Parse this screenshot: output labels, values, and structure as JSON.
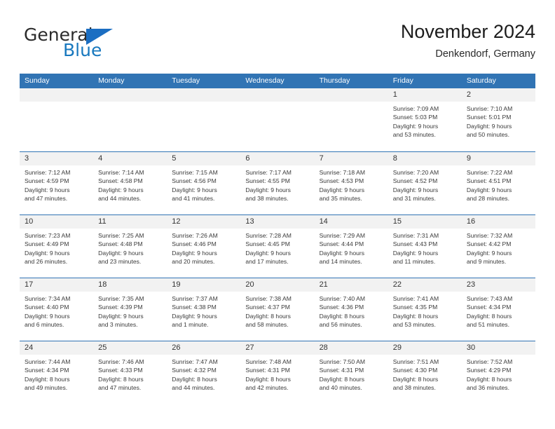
{
  "logo": {
    "primary_text": "General",
    "secondary_text": "Blue",
    "brand_color": "#1b6ec2"
  },
  "header": {
    "title": "November 2024",
    "subtitle": "Denkendorf, Germany"
  },
  "calendar": {
    "header_color": "#3174b4",
    "weekdays": [
      "Sunday",
      "Monday",
      "Tuesday",
      "Wednesday",
      "Thursday",
      "Friday",
      "Saturday"
    ],
    "weeks": [
      [
        {
          "day": "",
          "empty": true,
          "sunrise": "",
          "sunset": "",
          "daylight_line1": "",
          "daylight_line2": ""
        },
        {
          "day": "",
          "empty": true,
          "sunrise": "",
          "sunset": "",
          "daylight_line1": "",
          "daylight_line2": ""
        },
        {
          "day": "",
          "empty": true,
          "sunrise": "",
          "sunset": "",
          "daylight_line1": "",
          "daylight_line2": ""
        },
        {
          "day": "",
          "empty": true,
          "sunrise": "",
          "sunset": "",
          "daylight_line1": "",
          "daylight_line2": ""
        },
        {
          "day": "",
          "empty": true,
          "sunrise": "",
          "sunset": "",
          "daylight_line1": "",
          "daylight_line2": ""
        },
        {
          "day": "1",
          "empty": false,
          "sunrise": "Sunrise: 7:09 AM",
          "sunset": "Sunset: 5:03 PM",
          "daylight_line1": "Daylight: 9 hours",
          "daylight_line2": "and 53 minutes."
        },
        {
          "day": "2",
          "empty": false,
          "sunrise": "Sunrise: 7:10 AM",
          "sunset": "Sunset: 5:01 PM",
          "daylight_line1": "Daylight: 9 hours",
          "daylight_line2": "and 50 minutes."
        }
      ],
      [
        {
          "day": "3",
          "empty": false,
          "sunrise": "Sunrise: 7:12 AM",
          "sunset": "Sunset: 4:59 PM",
          "daylight_line1": "Daylight: 9 hours",
          "daylight_line2": "and 47 minutes."
        },
        {
          "day": "4",
          "empty": false,
          "sunrise": "Sunrise: 7:14 AM",
          "sunset": "Sunset: 4:58 PM",
          "daylight_line1": "Daylight: 9 hours",
          "daylight_line2": "and 44 minutes."
        },
        {
          "day": "5",
          "empty": false,
          "sunrise": "Sunrise: 7:15 AM",
          "sunset": "Sunset: 4:56 PM",
          "daylight_line1": "Daylight: 9 hours",
          "daylight_line2": "and 41 minutes."
        },
        {
          "day": "6",
          "empty": false,
          "sunrise": "Sunrise: 7:17 AM",
          "sunset": "Sunset: 4:55 PM",
          "daylight_line1": "Daylight: 9 hours",
          "daylight_line2": "and 38 minutes."
        },
        {
          "day": "7",
          "empty": false,
          "sunrise": "Sunrise: 7:18 AM",
          "sunset": "Sunset: 4:53 PM",
          "daylight_line1": "Daylight: 9 hours",
          "daylight_line2": "and 35 minutes."
        },
        {
          "day": "8",
          "empty": false,
          "sunrise": "Sunrise: 7:20 AM",
          "sunset": "Sunset: 4:52 PM",
          "daylight_line1": "Daylight: 9 hours",
          "daylight_line2": "and 31 minutes."
        },
        {
          "day": "9",
          "empty": false,
          "sunrise": "Sunrise: 7:22 AM",
          "sunset": "Sunset: 4:51 PM",
          "daylight_line1": "Daylight: 9 hours",
          "daylight_line2": "and 28 minutes."
        }
      ],
      [
        {
          "day": "10",
          "empty": false,
          "sunrise": "Sunrise: 7:23 AM",
          "sunset": "Sunset: 4:49 PM",
          "daylight_line1": "Daylight: 9 hours",
          "daylight_line2": "and 26 minutes."
        },
        {
          "day": "11",
          "empty": false,
          "sunrise": "Sunrise: 7:25 AM",
          "sunset": "Sunset: 4:48 PM",
          "daylight_line1": "Daylight: 9 hours",
          "daylight_line2": "and 23 minutes."
        },
        {
          "day": "12",
          "empty": false,
          "sunrise": "Sunrise: 7:26 AM",
          "sunset": "Sunset: 4:46 PM",
          "daylight_line1": "Daylight: 9 hours",
          "daylight_line2": "and 20 minutes."
        },
        {
          "day": "13",
          "empty": false,
          "sunrise": "Sunrise: 7:28 AM",
          "sunset": "Sunset: 4:45 PM",
          "daylight_line1": "Daylight: 9 hours",
          "daylight_line2": "and 17 minutes."
        },
        {
          "day": "14",
          "empty": false,
          "sunrise": "Sunrise: 7:29 AM",
          "sunset": "Sunset: 4:44 PM",
          "daylight_line1": "Daylight: 9 hours",
          "daylight_line2": "and 14 minutes."
        },
        {
          "day": "15",
          "empty": false,
          "sunrise": "Sunrise: 7:31 AM",
          "sunset": "Sunset: 4:43 PM",
          "daylight_line1": "Daylight: 9 hours",
          "daylight_line2": "and 11 minutes."
        },
        {
          "day": "16",
          "empty": false,
          "sunrise": "Sunrise: 7:32 AM",
          "sunset": "Sunset: 4:42 PM",
          "daylight_line1": "Daylight: 9 hours",
          "daylight_line2": "and 9 minutes."
        }
      ],
      [
        {
          "day": "17",
          "empty": false,
          "sunrise": "Sunrise: 7:34 AM",
          "sunset": "Sunset: 4:40 PM",
          "daylight_line1": "Daylight: 9 hours",
          "daylight_line2": "and 6 minutes."
        },
        {
          "day": "18",
          "empty": false,
          "sunrise": "Sunrise: 7:35 AM",
          "sunset": "Sunset: 4:39 PM",
          "daylight_line1": "Daylight: 9 hours",
          "daylight_line2": "and 3 minutes."
        },
        {
          "day": "19",
          "empty": false,
          "sunrise": "Sunrise: 7:37 AM",
          "sunset": "Sunset: 4:38 PM",
          "daylight_line1": "Daylight: 9 hours",
          "daylight_line2": "and 1 minute."
        },
        {
          "day": "20",
          "empty": false,
          "sunrise": "Sunrise: 7:38 AM",
          "sunset": "Sunset: 4:37 PM",
          "daylight_line1": "Daylight: 8 hours",
          "daylight_line2": "and 58 minutes."
        },
        {
          "day": "21",
          "empty": false,
          "sunrise": "Sunrise: 7:40 AM",
          "sunset": "Sunset: 4:36 PM",
          "daylight_line1": "Daylight: 8 hours",
          "daylight_line2": "and 56 minutes."
        },
        {
          "day": "22",
          "empty": false,
          "sunrise": "Sunrise: 7:41 AM",
          "sunset": "Sunset: 4:35 PM",
          "daylight_line1": "Daylight: 8 hours",
          "daylight_line2": "and 53 minutes."
        },
        {
          "day": "23",
          "empty": false,
          "sunrise": "Sunrise: 7:43 AM",
          "sunset": "Sunset: 4:34 PM",
          "daylight_line1": "Daylight: 8 hours",
          "daylight_line2": "and 51 minutes."
        }
      ],
      [
        {
          "day": "24",
          "empty": false,
          "sunrise": "Sunrise: 7:44 AM",
          "sunset": "Sunset: 4:34 PM",
          "daylight_line1": "Daylight: 8 hours",
          "daylight_line2": "and 49 minutes."
        },
        {
          "day": "25",
          "empty": false,
          "sunrise": "Sunrise: 7:46 AM",
          "sunset": "Sunset: 4:33 PM",
          "daylight_line1": "Daylight: 8 hours",
          "daylight_line2": "and 47 minutes."
        },
        {
          "day": "26",
          "empty": false,
          "sunrise": "Sunrise: 7:47 AM",
          "sunset": "Sunset: 4:32 PM",
          "daylight_line1": "Daylight: 8 hours",
          "daylight_line2": "and 44 minutes."
        },
        {
          "day": "27",
          "empty": false,
          "sunrise": "Sunrise: 7:48 AM",
          "sunset": "Sunset: 4:31 PM",
          "daylight_line1": "Daylight: 8 hours",
          "daylight_line2": "and 42 minutes."
        },
        {
          "day": "28",
          "empty": false,
          "sunrise": "Sunrise: 7:50 AM",
          "sunset": "Sunset: 4:31 PM",
          "daylight_line1": "Daylight: 8 hours",
          "daylight_line2": "and 40 minutes."
        },
        {
          "day": "29",
          "empty": false,
          "sunrise": "Sunrise: 7:51 AM",
          "sunset": "Sunset: 4:30 PM",
          "daylight_line1": "Daylight: 8 hours",
          "daylight_line2": "and 38 minutes."
        },
        {
          "day": "30",
          "empty": false,
          "sunrise": "Sunrise: 7:52 AM",
          "sunset": "Sunset: 4:29 PM",
          "daylight_line1": "Daylight: 8 hours",
          "daylight_line2": "and 36 minutes."
        }
      ]
    ]
  }
}
